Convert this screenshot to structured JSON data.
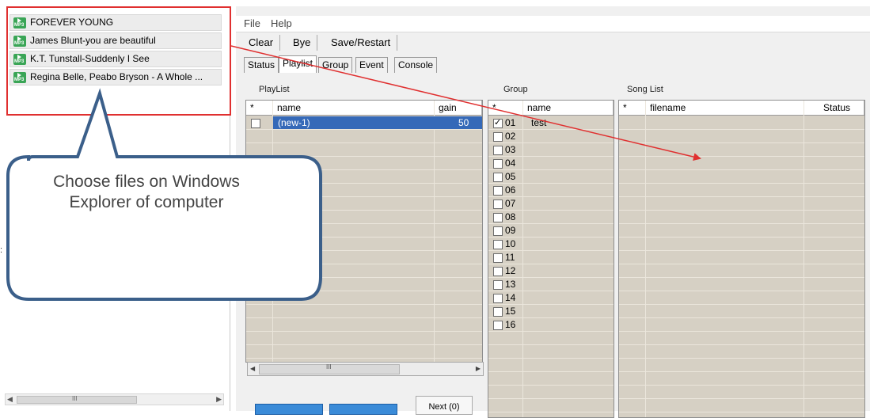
{
  "explorer": {
    "files": [
      "FOREVER YOUNG",
      "James Blunt-you are beautiful",
      "K.T. Tunstall-Suddenly I See",
      "Regina Belle, Peabo Bryson - A Whole ..."
    ],
    "scroll_grip": "III",
    "side_mark": ":"
  },
  "app": {
    "menu": {
      "file": "File",
      "help": "Help"
    },
    "toolbar": {
      "clear": "Clear",
      "bye": "Bye",
      "save_restart": "Save/Restart"
    },
    "tabs": [
      "Status",
      "Playlist",
      "Group",
      "Event",
      "Console"
    ],
    "active_tab": "Playlist",
    "playlist": {
      "title": "PlayList",
      "columns": [
        "*",
        "name",
        "gain"
      ],
      "rows": [
        {
          "checked": false,
          "name": "(new-1)",
          "gain": "50",
          "selected": true
        }
      ],
      "scroll_grip": "III"
    },
    "group": {
      "title": "Group",
      "columns": [
        "*",
        "name"
      ],
      "rows": [
        {
          "id": "01",
          "name": "test",
          "checked": true
        },
        {
          "id": "02",
          "name": "",
          "checked": false
        },
        {
          "id": "03",
          "name": "",
          "checked": false
        },
        {
          "id": "04",
          "name": "",
          "checked": false
        },
        {
          "id": "05",
          "name": "",
          "checked": false
        },
        {
          "id": "06",
          "name": "",
          "checked": false
        },
        {
          "id": "07",
          "name": "",
          "checked": false
        },
        {
          "id": "08",
          "name": "",
          "checked": false
        },
        {
          "id": "09",
          "name": "",
          "checked": false
        },
        {
          "id": "10",
          "name": "",
          "checked": false
        },
        {
          "id": "11",
          "name": "",
          "checked": false
        },
        {
          "id": "12",
          "name": "",
          "checked": false
        },
        {
          "id": "13",
          "name": "",
          "checked": false
        },
        {
          "id": "14",
          "name": "",
          "checked": false
        },
        {
          "id": "15",
          "name": "",
          "checked": false
        },
        {
          "id": "16",
          "name": "",
          "checked": false
        }
      ]
    },
    "songlist": {
      "title": "Song List",
      "columns": [
        "*",
        "filename",
        "Status"
      ]
    },
    "next_button": "Next (0)"
  },
  "annotation": {
    "callout_text": "Choose files on Windows Explorer of computer",
    "colors": {
      "highlight": "#e03030",
      "callout_border": "#3b5f8a",
      "selected_row": "#3569b8"
    }
  }
}
